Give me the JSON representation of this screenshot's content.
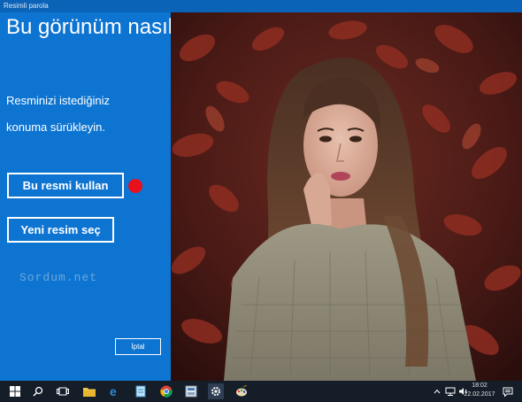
{
  "window": {
    "title": "Resimli parola"
  },
  "panel": {
    "heading": "Bu görünüm nasıl?",
    "instruction_line1": "Resminizi istediğiniz",
    "instruction_line2": "konuma sürükleyin.",
    "use_picture_button": "Bu resmi kullan",
    "choose_new_button": "Yeni resim seç",
    "watermark": "Sordum.net",
    "cancel_button": "İptal"
  },
  "colors": {
    "panel_blue": "#0d74d2",
    "titlebar": "#0b63b8",
    "marker_red": "#e8101d",
    "taskbar": "#141d28"
  },
  "taskbar": {
    "icons": [
      "windows-start-icon",
      "search-icon",
      "task-view-icon",
      "file-explorer-icon",
      "edge-icon",
      "notepad-icon",
      "chrome-icon",
      "app-icon",
      "settings-icon",
      "paint-icon"
    ],
    "clock_time": "18:02",
    "clock_date": "22.02.2017"
  }
}
